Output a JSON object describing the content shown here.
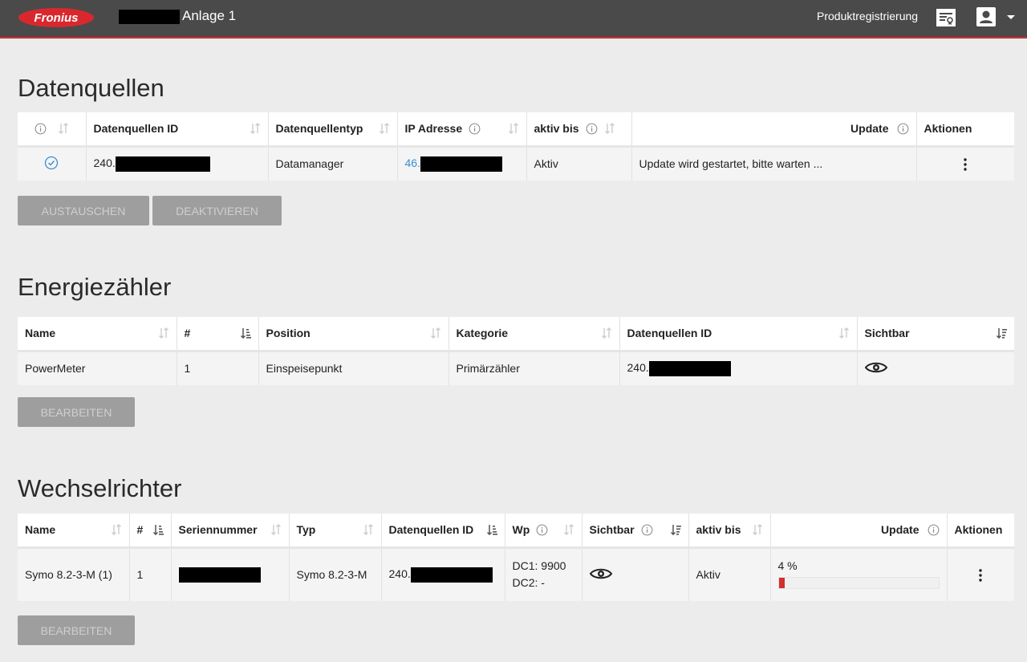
{
  "header": {
    "brand": "Fronius",
    "plant_name": "Anlage 1",
    "product_registration": "Produktregistrierung",
    "colors": {
      "bar": "#4a4a4a",
      "accent": "#d8282e"
    }
  },
  "datasources": {
    "title": "Datenquellen",
    "columns": {
      "id": "Datenquellen ID",
      "type": "Datenquellentyp",
      "ip": "IP Adresse",
      "active_until": "aktiv bis",
      "update": "Update",
      "actions": "Aktionen"
    },
    "row": {
      "status_icon": "check-circle-icon",
      "id_prefix": "240.",
      "type": "Datamanager",
      "ip_prefix": "46.",
      "active": "Aktiv",
      "update": "Update wird gestartet, bitte warten ..."
    },
    "buttons": {
      "replace": "AUSTAUSCHEN",
      "deactivate": "DEAKTIVIEREN"
    }
  },
  "meters": {
    "title": "Energiezähler",
    "columns": {
      "name": "Name",
      "number": "#",
      "position": "Position",
      "category": "Kategorie",
      "id": "Datenquellen ID",
      "visible": "Sichtbar"
    },
    "row": {
      "name": "PowerMeter",
      "number": "1",
      "position": "Einspeisepunkt",
      "category": "Primärzähler",
      "id_prefix": "240.",
      "visible_icon": "eye-icon"
    },
    "button": "BEARBEITEN"
  },
  "inverters": {
    "title": "Wechselrichter",
    "columns": {
      "name": "Name",
      "number": "#",
      "serial": "Seriennummer",
      "type": "Typ",
      "id": "Datenquellen ID",
      "wp": "Wp",
      "visible": "Sichtbar",
      "active_until": "aktiv bis",
      "update": "Update",
      "actions": "Aktionen"
    },
    "row": {
      "name": "Symo 8.2-3-M (1)",
      "number": "1",
      "type": "Symo 8.2-3-M",
      "id_prefix": "240.",
      "dc1": "DC1: 9900",
      "dc2": "DC2: -",
      "visible_icon": "eye-icon",
      "active": "Aktiv",
      "update_label": "4 %",
      "update_progress": 0.04
    },
    "button": "BEARBEITEN"
  }
}
